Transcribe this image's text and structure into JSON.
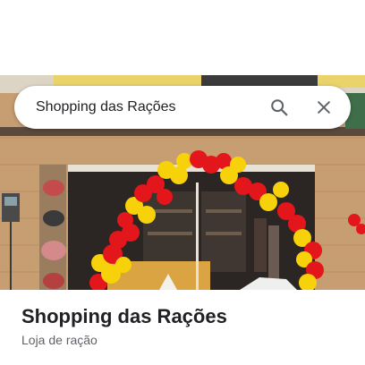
{
  "search": {
    "query": "Shopping das Rações",
    "search_icon": "search-icon",
    "close_icon": "close-icon"
  },
  "place": {
    "name": "Shopping das Rações",
    "category": "Loja de ração"
  },
  "colors": {
    "title": "#202124",
    "subtitle": "#5f6368",
    "icon": "#5f6368",
    "balloon_red": "#e3161b",
    "balloon_yellow": "#f7d20a"
  }
}
